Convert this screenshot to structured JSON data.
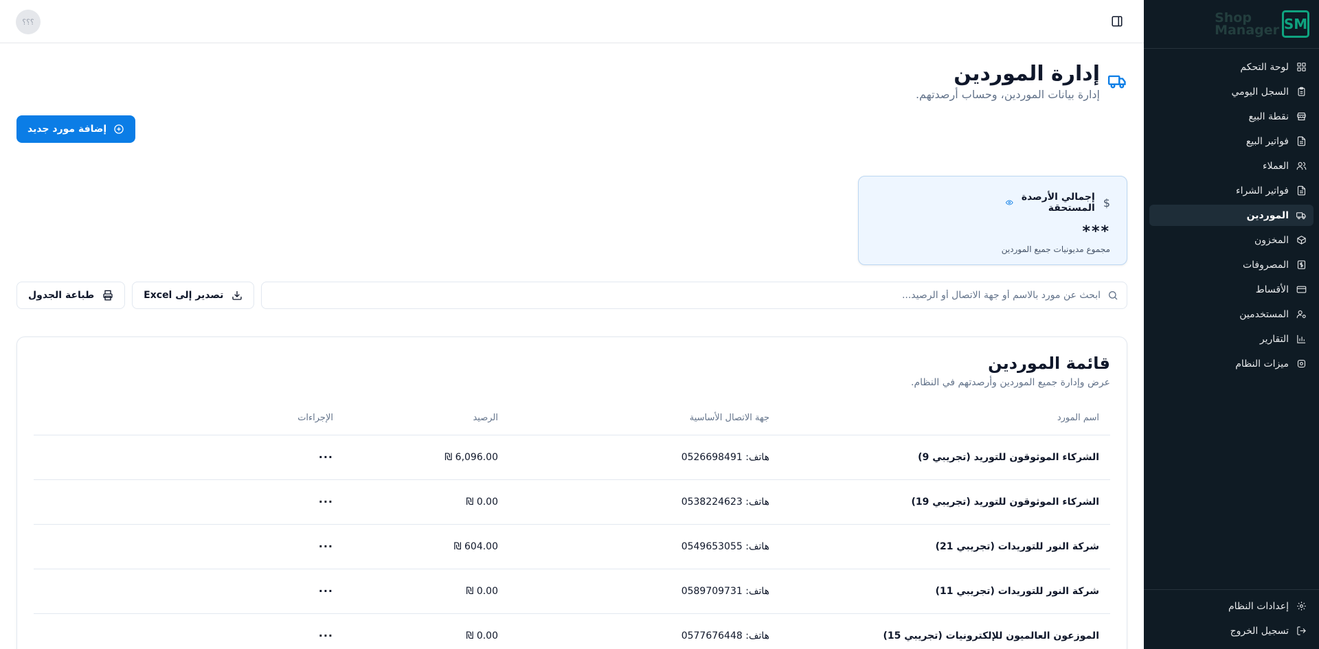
{
  "app": {
    "logo_letters": "SM",
    "logo_line1": "Shop",
    "logo_line2": "Manager",
    "avatar_text": "؟؟؟"
  },
  "sidebar": {
    "items": [
      {
        "label": "لوحة التحكم",
        "icon": "grid-icon"
      },
      {
        "label": "السجل اليومي",
        "icon": "clipboard-icon"
      },
      {
        "label": "نقطة البيع",
        "icon": "store-icon"
      },
      {
        "label": "فواتير البيع",
        "icon": "file-text-icon"
      },
      {
        "label": "العملاء",
        "icon": "users-icon"
      },
      {
        "label": "فواتير الشراء",
        "icon": "file-text-icon"
      },
      {
        "label": "الموردين",
        "icon": "truck-icon",
        "active": true
      },
      {
        "label": "المخزون",
        "icon": "package-icon"
      },
      {
        "label": "المصروفات",
        "icon": "receipt-icon"
      },
      {
        "label": "الأقساط",
        "icon": "credit-card-icon"
      },
      {
        "label": "المستخدمين",
        "icon": "user-cog-icon"
      },
      {
        "label": "التقارير",
        "icon": "bar-chart-icon"
      },
      {
        "label": "ميزات النظام",
        "icon": "settings-icon"
      }
    ],
    "footer": [
      {
        "label": "إعدادات النظام",
        "icon": "gear-icon"
      },
      {
        "label": "تسجيل الخروج",
        "icon": "logout-icon"
      }
    ]
  },
  "header": {
    "title": "إدارة الموردين",
    "subtitle": "إدارة بيانات الموردين، وحساب أرصدتهم.",
    "add_button": "إضافة مورد جديد"
  },
  "stat_card": {
    "title": "إجمالي الأرصدة المستحقة",
    "value": "***",
    "description": "مجموع مديونيات جميع الموردين"
  },
  "toolbar": {
    "search_placeholder": "ابحث عن مورد بالاسم أو جهة الاتصال أو الرصيد...",
    "search_value": "",
    "export_label": "تصدير إلى Excel",
    "print_label": "طباعة الجدول"
  },
  "table": {
    "title": "قائمة الموردين",
    "subtitle": "عرض وإدارة جميع الموردين وأرصدتهم في النظام.",
    "columns": [
      "اسم المورد",
      "جهة الاتصال الأساسية",
      "الرصيد",
      "الإجراءات"
    ],
    "rows": [
      {
        "name": "الشركاء الموثوقون للتوريد (تجريبي 9)",
        "contact": "هاتف: 0526698491",
        "balance": "6,096.00 ₪",
        "actions": "···"
      },
      {
        "name": "الشركاء الموثوقون للتوريد (تجريبي 19)",
        "contact": "هاتف: 0538224623",
        "balance": "0.00 ₪",
        "actions": "···"
      },
      {
        "name": "شركة النور للتوريدات (تجريبي 21)",
        "contact": "هاتف: 0549653055",
        "balance": "604.00 ₪",
        "actions": "···"
      },
      {
        "name": "شركة النور للتوريدات (تجريبي 11)",
        "contact": "هاتف: 0589709731",
        "balance": "0.00 ₪",
        "actions": "···"
      },
      {
        "name": "الموزعون العالميون للإلكترونيات (تجريبي 15)",
        "contact": "هاتف: 0577676448",
        "balance": "0.00 ₪",
        "actions": "···"
      }
    ]
  },
  "colors": {
    "sidebar_bg": "#0f1b24",
    "accent": "#0b7de6",
    "logo_green": "#0fa37f"
  }
}
